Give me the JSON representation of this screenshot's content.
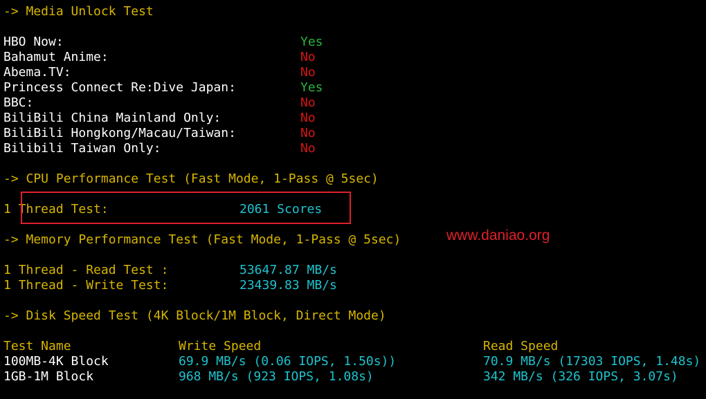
{
  "media": {
    "header": "-> Media Unlock Test",
    "items": [
      {
        "label": "HBO Now:",
        "status": "Yes"
      },
      {
        "label": "Bahamut Anime:",
        "status": "No"
      },
      {
        "label": "Abema.TV:",
        "status": "No"
      },
      {
        "label": "Princess Connect Re:Dive Japan:",
        "status": "Yes"
      },
      {
        "label": "BBC:",
        "status": "No"
      },
      {
        "label": "BiliBili China Mainland Only:",
        "status": "No"
      },
      {
        "label": "BiliBili Hongkong/Macau/Taiwan:",
        "status": "No"
      },
      {
        "label": "Bilibili Taiwan Only:",
        "status": "No"
      }
    ]
  },
  "cpu": {
    "header": "-> CPU Performance Test (Fast Mode, 1-Pass @ 5sec)",
    "label": "1 Thread Test:",
    "value": "2061 Scores"
  },
  "memory": {
    "header": "-> Memory Performance Test (Fast Mode, 1-Pass @ 5sec)",
    "read_label": "1 Thread - Read Test :",
    "read_value": "53647.87 MB/s",
    "write_label": "1 Thread - Write Test:",
    "write_value": "23439.83 MB/s"
  },
  "disk": {
    "header": "-> Disk Speed Test (4K Block/1M Block, Direct Mode)",
    "columns": [
      "Test Name",
      "Write Speed",
      "Read Speed"
    ],
    "rows": [
      {
        "name": "100MB-4K Block",
        "write": "69.9 MB/s (0.06 IOPS, 1.50s))",
        "read": "70.9 MB/s (17303 IOPS, 1.48s)"
      },
      {
        "name": "1GB-1M Block",
        "write": "968 MB/s (923 IOPS, 1.08s)",
        "read": "342 MB/s (326 IOPS, 3.07s)"
      }
    ]
  },
  "watermark": "www.daniao.org",
  "colors": {
    "header": "#d7b600",
    "yes": "#2bb53c",
    "no": "#d81414",
    "value": "#1ec3ce",
    "highlight": "#e0202a"
  }
}
